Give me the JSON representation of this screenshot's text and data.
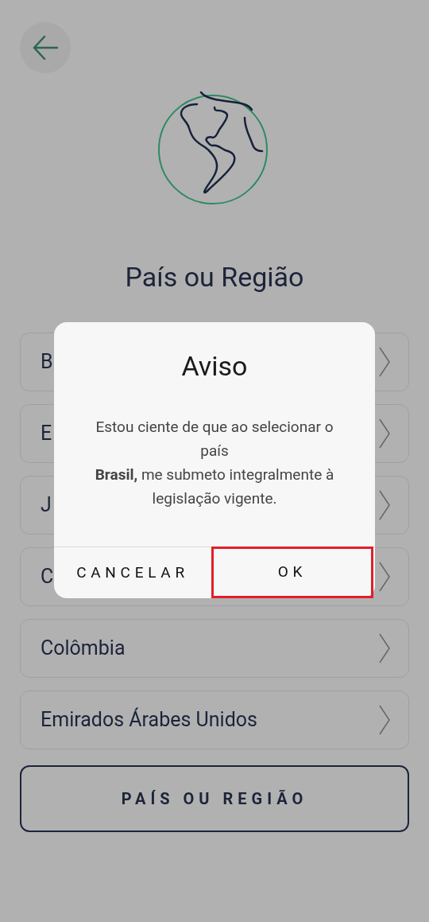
{
  "title": "País ou Região",
  "countries": [
    {
      "label": "B"
    },
    {
      "label": "E"
    },
    {
      "label": "J"
    },
    {
      "label": "C"
    },
    {
      "label": "Colômbia"
    },
    {
      "label": "Emirados Árabes Unidos"
    }
  ],
  "bottom_button": "PAÍS OU REGIÃO",
  "dialog": {
    "title": "Aviso",
    "message": "Estou ciente de que ao selecionar o\npaís\n**Brasil,** me submeto integralmente à\nlegislação vigente.",
    "buttons": [
      {
        "label": "CANCELAR",
        "highlighted": false
      },
      {
        "label": "OK",
        "highlighted": true
      }
    ]
  }
}
